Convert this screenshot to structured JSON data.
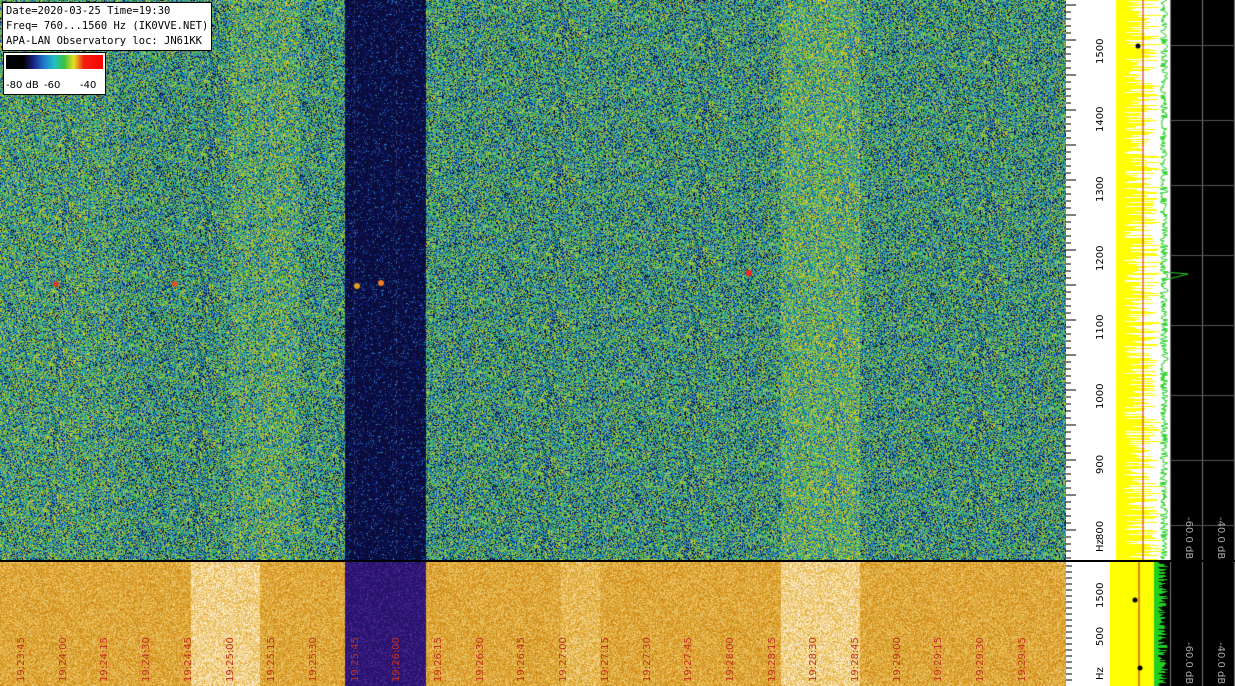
{
  "header": {
    "date_time": "Date=2020-03-25 Time=19:30",
    "freq_range": "Freq= 760...1560 Hz (IK0VVE.NET)",
    "observatory": "APA-LAN Observatory loc: JN61KK"
  },
  "color_scale": {
    "labels": [
      "-80 dB",
      "-60",
      "-40"
    ],
    "colors": [
      "#000000",
      "#1a2080",
      "#1f7fd0",
      "#20c0c0",
      "#3ac040",
      "#e8e020",
      "#f02010"
    ]
  },
  "frequency_axis_top": {
    "unit": "Hz",
    "ticks": [
      "800",
      "900",
      "1000",
      "1100",
      "1200",
      "1300",
      "1400",
      "1500"
    ]
  },
  "frequency_axis_bottom": {
    "unit": "Hz",
    "ticks": [
      "500",
      "1500"
    ]
  },
  "time_axis": {
    "ticks": [
      "19:23:45",
      "19:24:00",
      "19:24:15",
      "19:24:30",
      "19:24:45",
      "19:25:00",
      "19:25:15",
      "19:25:30",
      "19:25:45",
      "19:26:00",
      "19:26:15",
      "19:26:30",
      "19:26:45",
      "19:27:00",
      "19:27:15",
      "19:27:30",
      "19:27:45",
      "19:28:00",
      "19:28:15",
      "19:28:30",
      "19:28:45",
      "19:29:00",
      "19:29:15",
      "19:29:30",
      "19:29:45"
    ]
  },
  "spectrum_scale_top": [
    "-60.0 dB",
    "-40.0 dB"
  ],
  "spectrum_scale_bottom": [
    "-60.0 dB",
    "-40.0 dB"
  ]
}
